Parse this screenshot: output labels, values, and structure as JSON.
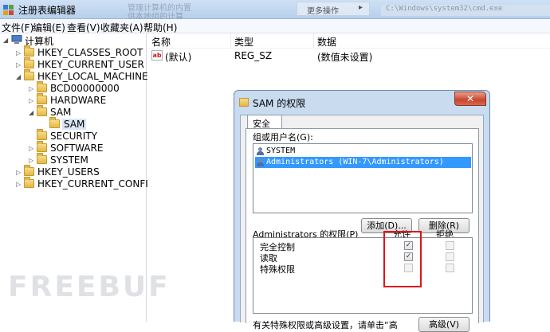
{
  "window": {
    "title": "注册表编辑器",
    "ghost_text_1": "管理计算机的内置",
    "ghost_text_2": "供本地组的计算",
    "ghost_button": "更多操作",
    "ghost_path": "C:\\Windows\\system32\\cmd.exe"
  },
  "menu": [
    "文件(F)",
    "编辑(E)",
    "查看(V)",
    "收藏夹(A)",
    "帮助(H)"
  ],
  "tree": {
    "root": "计算机",
    "items": [
      {
        "label": "HKEY_CLASSES_ROOT"
      },
      {
        "label": "HKEY_CURRENT_USER"
      },
      {
        "label": "HKEY_LOCAL_MACHINE"
      },
      {
        "label": "BCD00000000"
      },
      {
        "label": "HARDWARE"
      },
      {
        "label": "SAM"
      },
      {
        "label": "SAM"
      },
      {
        "label": "SECURITY"
      },
      {
        "label": "SOFTWARE"
      },
      {
        "label": "SYSTEM"
      },
      {
        "label": "HKEY_USERS"
      },
      {
        "label": "HKEY_CURRENT_CONFIG"
      }
    ]
  },
  "list": {
    "columns": [
      "名称",
      "类型",
      "数据"
    ],
    "rows": [
      {
        "name": "(默认)",
        "type": "REG_SZ",
        "data": "(数值未设置)",
        "icon": "ab"
      }
    ]
  },
  "dialog": {
    "title": "SAM 的权限",
    "close_symbol": "✕",
    "tab": "安全",
    "group_label": "组或用户名(G):",
    "users": [
      "SYSTEM",
      "Administrators (WIN-7\\Administrators)"
    ],
    "add_button": "添加(D)...",
    "remove_button": "删除(R)",
    "perm_label": "Administrators 的权限(P)",
    "allow_header": "允许",
    "deny_header": "拒绝",
    "permissions": [
      {
        "name": "完全控制",
        "allow": "✓",
        "deny": ""
      },
      {
        "name": "读取",
        "allow": "✓",
        "deny": ""
      },
      {
        "name": "特殊权限",
        "allow": "",
        "deny": ""
      }
    ],
    "footer_text": "有关特殊权限或高级设置，请单击“高",
    "advanced_button": "高级(V)"
  },
  "watermark": "FREEBUF"
}
